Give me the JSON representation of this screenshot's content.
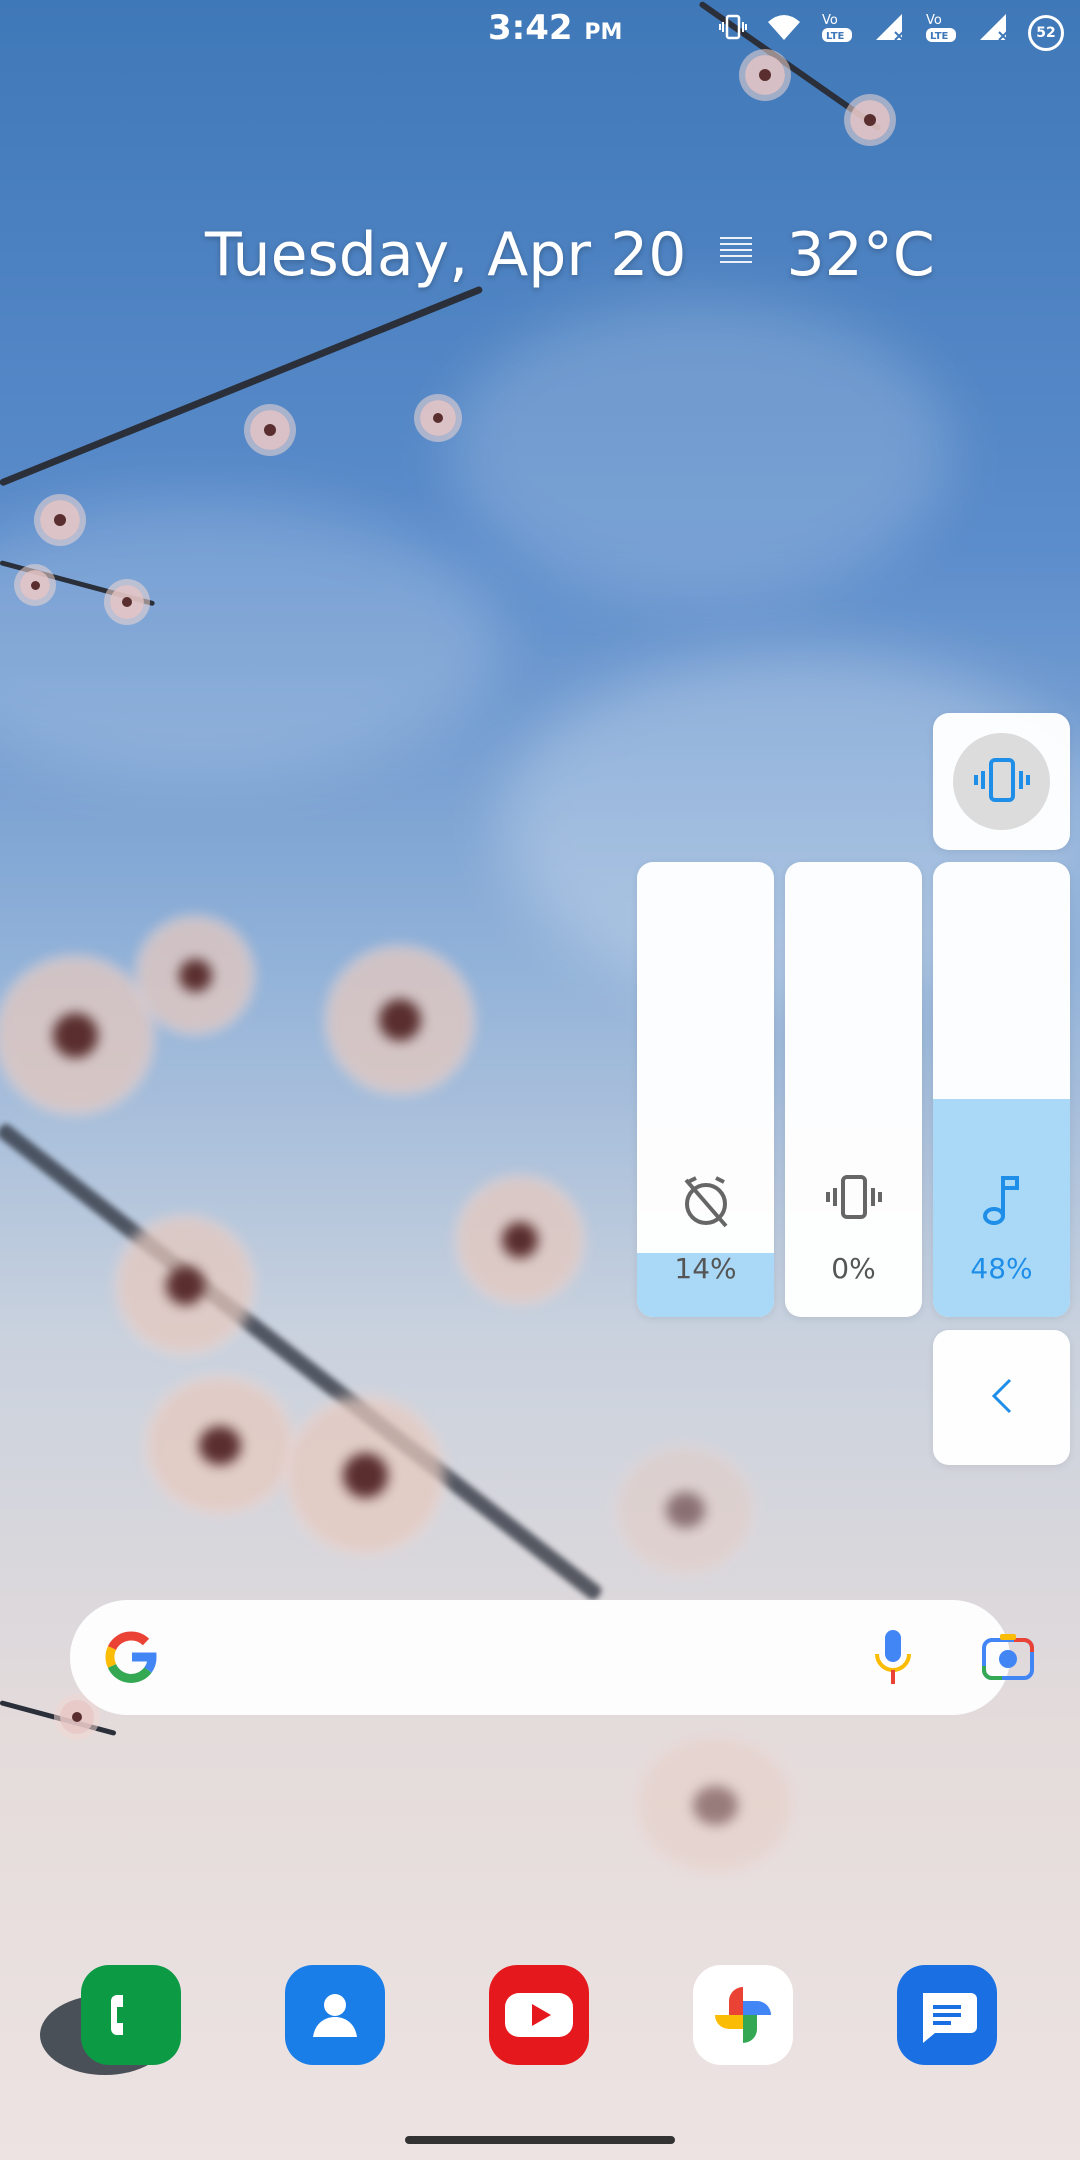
{
  "status_bar": {
    "time": "3:42",
    "ampm": "PM",
    "icons": [
      "vibrate-icon",
      "wifi-icon",
      "volte-lte-icon",
      "signal-no-service-icon",
      "volte-lte-icon",
      "signal-no-service-icon"
    ],
    "battery": "52"
  },
  "widget": {
    "date": "Tuesday, Apr 20",
    "weather_icon": "haze-icon",
    "temperature": "32°C"
  },
  "volume_panel": {
    "ringer_mode_icon": "vibrate-icon",
    "sliders": [
      {
        "name": "alarm",
        "icon": "alarm-off-icon",
        "value_label": "14%",
        "level": 0.14
      },
      {
        "name": "ring",
        "icon": "vibrate-icon",
        "value_label": "0%",
        "level": 0.0
      },
      {
        "name": "media",
        "icon": "music-note-icon",
        "value_label": "48%",
        "level": 0.48
      }
    ],
    "collapse_icon": "chevron-left-icon"
  },
  "search_bar": {
    "logo": "google-g-icon",
    "mic_icon": "mic-icon",
    "lens_icon": "google-lens-icon"
  },
  "dock": [
    {
      "app": "phone",
      "icon": "phone-icon",
      "color": "#0d9a45"
    },
    {
      "app": "contacts",
      "icon": "contacts-icon",
      "color": "#1a7ee8"
    },
    {
      "app": "youtube",
      "icon": "youtube-icon",
      "color": "#e5191d"
    },
    {
      "app": "photos",
      "icon": "photos-pinwheel-icon",
      "color": "#ffffff"
    },
    {
      "app": "messages",
      "icon": "messages-icon",
      "color": "#1a6fe3"
    }
  ],
  "colors": {
    "accent": "#1f8ee8",
    "slider_fill": "#a9d9f7"
  }
}
